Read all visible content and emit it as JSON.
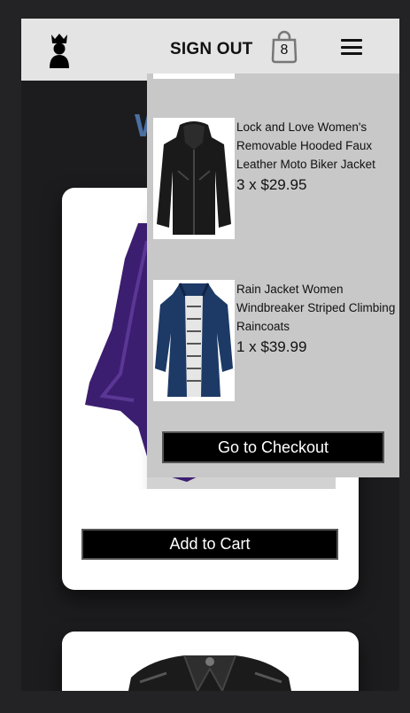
{
  "header": {
    "logo_icon": "crown-person-icon",
    "sign_out_label": "SIGN OUT",
    "cart_count": "8",
    "cart_icon": "shopping-bag-icon",
    "menu_icon": "hamburger-menu-icon"
  },
  "main": {
    "title_fragment": "W",
    "products": [
      {
        "image": "purple-jacket-image",
        "add_to_cart_label": "Add to Cart"
      },
      {
        "image": "black-leather-jacket-image"
      }
    ]
  },
  "cart": {
    "items": [
      {
        "name": "Lock and Love Women's Removable Hooded Faux Leather Moto Biker Jacket",
        "qty_price": "3 x $29.95",
        "image": "black-leather-jacket-thumb"
      },
      {
        "name": "Rain Jacket Women Windbreaker Striped Climbing Raincoats",
        "qty_price": "1 x $39.99",
        "image": "navy-raincoat-thumb"
      }
    ],
    "checkout_label": "Go to Checkout"
  },
  "colors": {
    "page_bg": "#232325",
    "header_bg": "#e4e4e4",
    "dropdown_bg": "#c8c8c8",
    "button_bg": "#000000",
    "title_blue": "#4a6fa0"
  }
}
